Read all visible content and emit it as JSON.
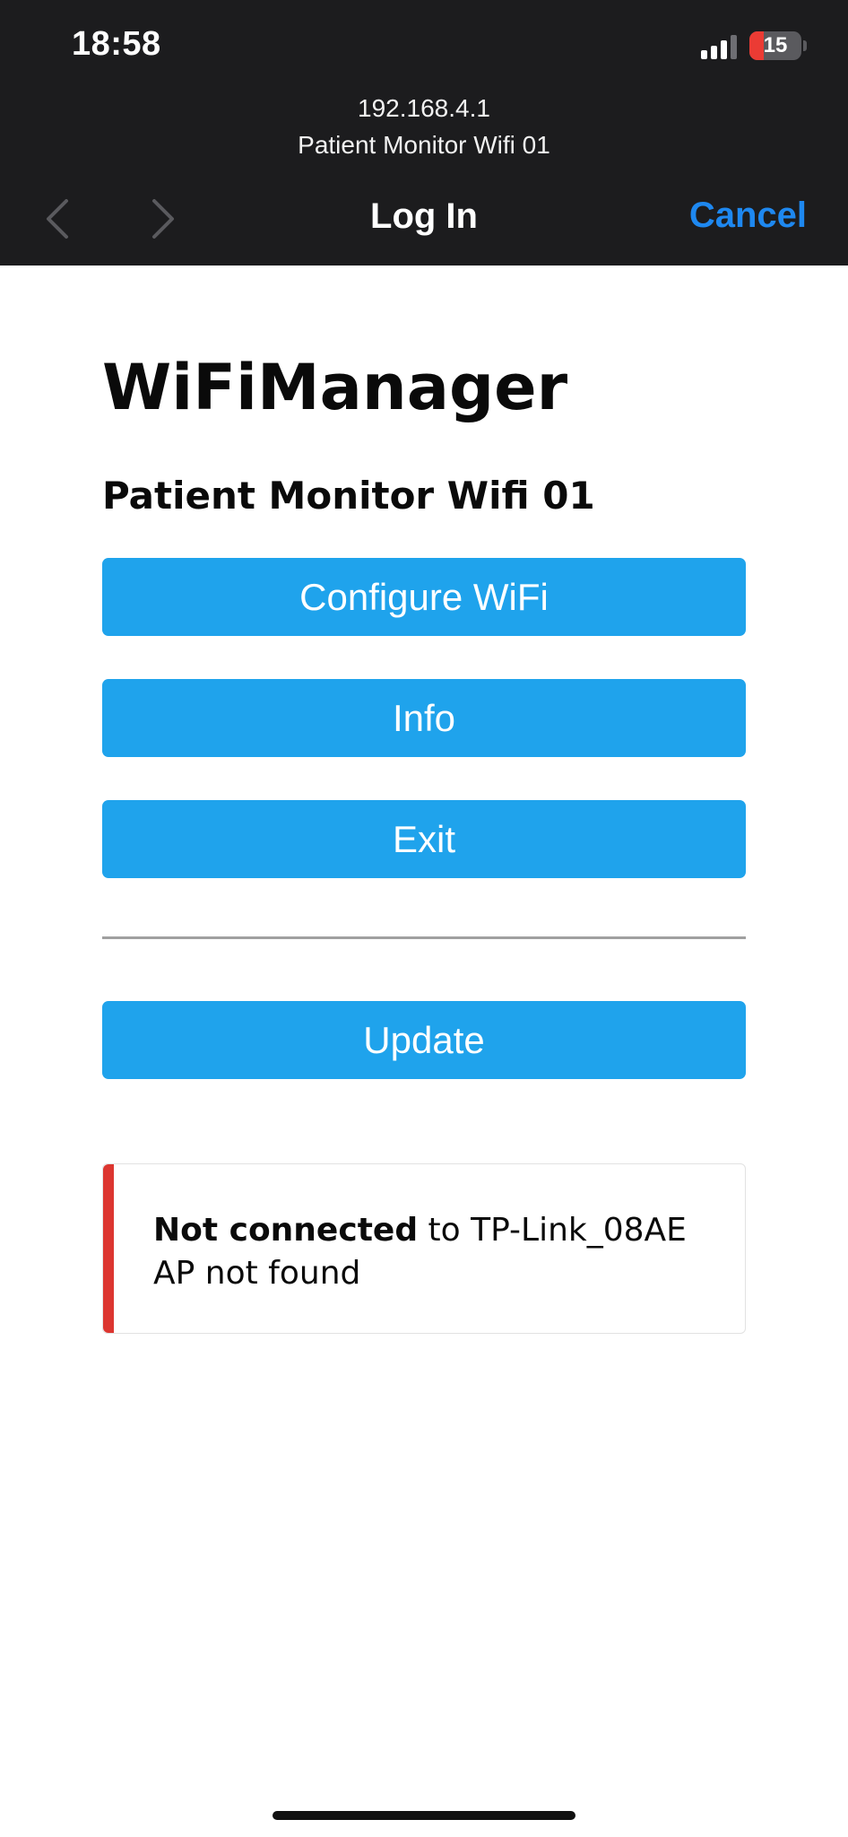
{
  "status_bar": {
    "time": "18:58",
    "battery_level": "15",
    "battery_fill_percent": 28,
    "battery_color": "#eb3b34"
  },
  "header": {
    "url": "192.168.4.1",
    "network_name": "Patient Monitor Wifi 01",
    "title": "Log In",
    "cancel_label": "Cancel",
    "back_icon": "chevron-left-icon",
    "forward_icon": "chevron-right-icon"
  },
  "page": {
    "title": "WiFiManager",
    "subtitle": "Patient Monitor Wifi 01",
    "buttons": {
      "configure": "Configure WiFi",
      "info": "Info",
      "exit": "Exit",
      "update": "Update"
    },
    "status_message": {
      "strong": "Not connected",
      "rest": " to TP-Link_08AE",
      "line2": "AP not found",
      "accent_color": "#dc3630"
    }
  },
  "colors": {
    "header_bg": "#1c1c1e",
    "button_bg": "#1fa3ec",
    "link_blue": "#1e88f0"
  }
}
